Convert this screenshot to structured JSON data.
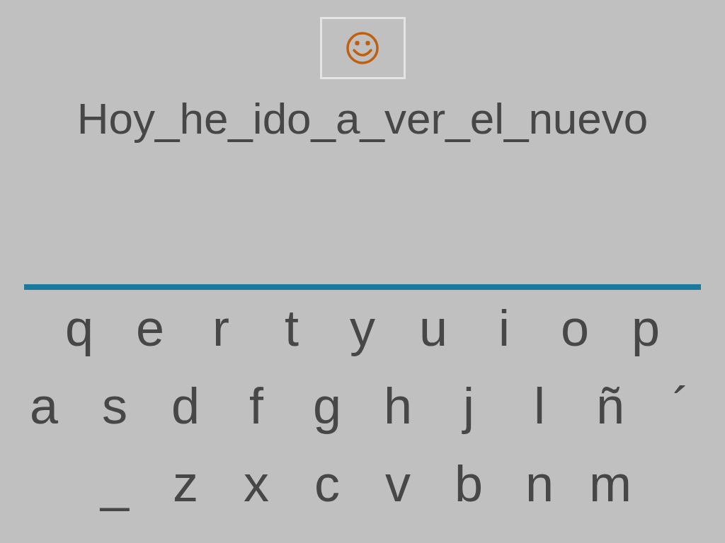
{
  "prompt": {
    "text": "Hoy_he_ido_a_ver_el_nuevo"
  },
  "keyboard": {
    "rows": [
      [
        "q",
        "e",
        "r",
        "t",
        "y",
        "u",
        "i",
        "o",
        "p"
      ],
      [
        "a",
        "s",
        "d",
        "f",
        "g",
        "h",
        "j",
        "l",
        "ñ",
        "´"
      ],
      [
        "_",
        "z",
        "x",
        "c",
        "v",
        "b",
        "n",
        "m"
      ]
    ]
  }
}
